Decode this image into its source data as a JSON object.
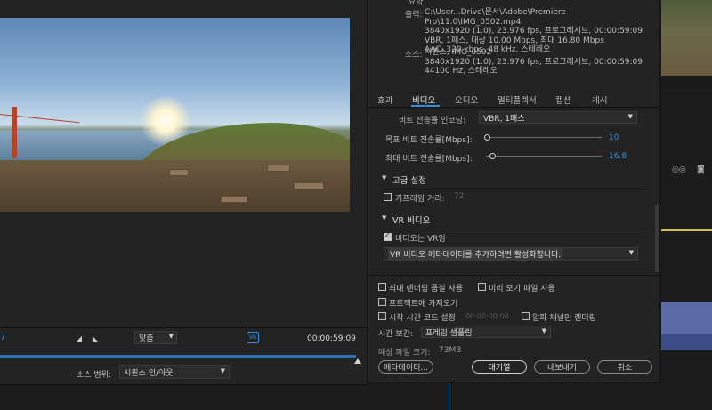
{
  "left_monitor": {
    "timecode_left": "7",
    "fit_label": "맞춤",
    "duration": "00:00:59:09",
    "source_range_label": "소스 범위:",
    "source_range_value": "시퀀스 인/아웃"
  },
  "summary": {
    "section_title": "요약",
    "output_label": "출력:",
    "output_lines": [
      "C:\\User...Drive\\문서\\Adobe\\Premiere Pro\\11.0\\IMG_0502.mp4",
      "3840x1920 (1.0), 23.976 fps, 프로그레시브, 00:00:59:09",
      "VBR, 1패스, 대상 10.00 Mbps, 최대 16.80 Mbps",
      "AAC, 320 kbps, 48 kHz, 스테레오"
    ],
    "source_label": "소스:",
    "source_lines": [
      "시퀀스, IMG_0502",
      "3840x1920 (1.0), 23.976 fps, 프로그레시브, 00:00:59:09",
      "44100 Hz, 스테레오"
    ]
  },
  "tabs": [
    {
      "label": "효과",
      "active": false
    },
    {
      "label": "비디오",
      "active": true
    },
    {
      "label": "오디오",
      "active": false
    },
    {
      "label": "멀티플렉서",
      "active": false
    },
    {
      "label": "캡션",
      "active": false
    },
    {
      "label": "게시",
      "active": false
    }
  ],
  "video_settings": {
    "bitrate_encoding_label": "비트 전송률 인코딩:",
    "bitrate_encoding_value": "VBR, 1패스",
    "target_bitrate_label": "목표 비트 전송률[Mbps]:",
    "target_bitrate_value": "10",
    "target_bitrate_level": 0.0,
    "max_bitrate_label": "최대 비트 전송률[Mbps]:",
    "max_bitrate_value": "16.8",
    "max_bitrate_level": 0.04,
    "advanced_title": "고급 설정",
    "keyframe_label": "키프레임 거리:",
    "keyframe_value": "72",
    "vr_title": "VR 비디오",
    "vr_checkbox_label": "비디오는 VR임",
    "vr_checked": true,
    "vr_dropdown_value": "VR 비디오 메타데이터를 추가하려면 활성화합니다."
  },
  "bottom_options": {
    "max_render_quality": "최대 렌더링 품질 사용",
    "use_previews": "미리 보기 파일 사용",
    "import_into_project": "프로젝트에 가져오기",
    "set_start_timecode": "시작 시간 코드 설정",
    "start_timecode_value": "00:00:00:00",
    "render_alpha": "알파 채널만 렌더링",
    "time_interpolation_label": "시간 보간:",
    "time_interpolation_value": "프레임 샘플링",
    "estimated_size_label": "예상 파일 크기:",
    "estimated_size_value": "73MB"
  },
  "buttons": {
    "metadata": "메타데이터...",
    "queue": "대기열",
    "export": "내보내기",
    "cancel": "취소"
  },
  "colors": {
    "accent": "#2f8fe0",
    "panel": "#232323",
    "timeline_marker": "#d6c23a",
    "clip": "#5a6aa8"
  }
}
